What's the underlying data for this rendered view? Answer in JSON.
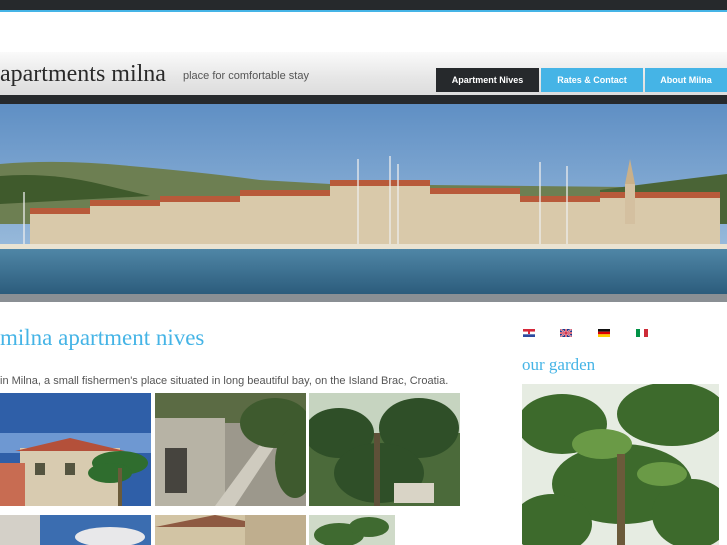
{
  "header": {
    "logo_text": "apartments milna",
    "tagline": "place for comfortable stay",
    "nav": [
      {
        "label": "Apartment Nives"
      },
      {
        "label": "Rates & Contact"
      },
      {
        "label": "About Milna"
      }
    ]
  },
  "colors": {
    "accent": "#45b4e6",
    "dark": "#26292c"
  },
  "main": {
    "title": "milna apartment nives",
    "intro": "in Milna, a small fishermen's place situated in long beautiful bay, on the Island Brac, Croatia."
  },
  "sidebar": {
    "languages": [
      "Croatian",
      "English",
      "German",
      "Italian"
    ],
    "garden_title": "our garden"
  }
}
